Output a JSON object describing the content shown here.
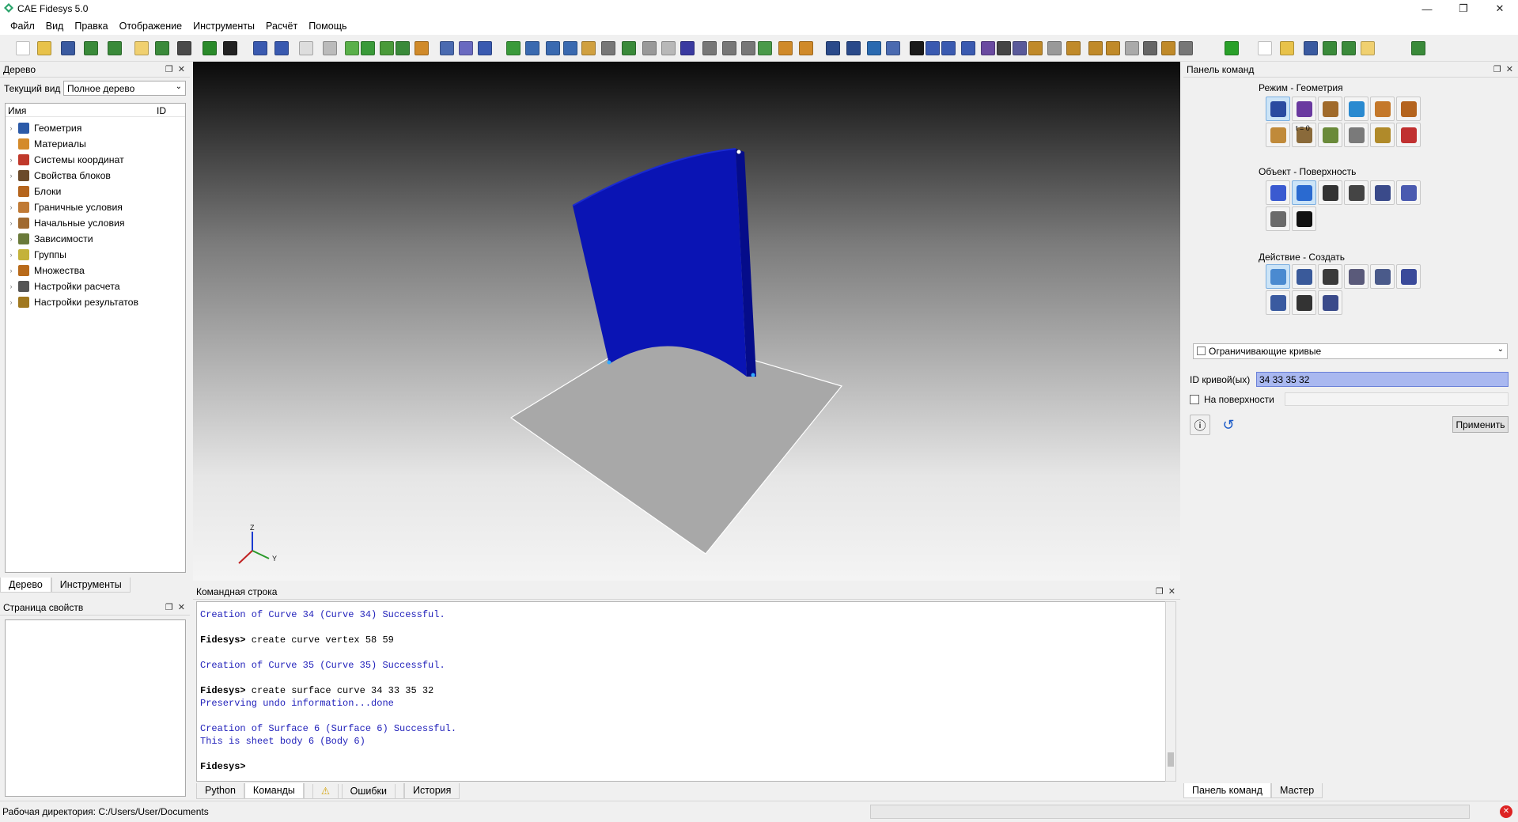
{
  "window": {
    "title": "CAE Fidesys 5.0",
    "min": "—",
    "max": "❐",
    "close": "✕"
  },
  "menu": [
    "Файл",
    "Вид",
    "Правка",
    "Отображение",
    "Инструменты",
    "Расчёт",
    "Помощь"
  ],
  "tree_panel": {
    "title": "Дерево",
    "current_view_label": "Текущий вид",
    "current_view_value": "Полное дерево",
    "col_name": "Имя",
    "col_id": "ID",
    "items": [
      {
        "label": "Геометрия",
        "icon": "geometry-icon",
        "color": "#2b5aa8",
        "expand": true
      },
      {
        "label": "Материалы",
        "icon": "materials-icon",
        "color": "#d48a2a",
        "expand": false
      },
      {
        "label": "Системы координат",
        "icon": "axes-icon",
        "color": "#c0392b",
        "expand": true
      },
      {
        "label": "Свойства блоков",
        "icon": "beam-icon",
        "color": "#6b4a2a",
        "expand": true
      },
      {
        "label": "Блоки",
        "icon": "blocks-icon",
        "color": "#b5651d",
        "expand": false
      },
      {
        "label": "Граничные условия",
        "icon": "boundary-icon",
        "color": "#c07a35",
        "expand": true
      },
      {
        "label": "Начальные условия",
        "icon": "initial-icon",
        "color": "#a06a30",
        "expand": true
      },
      {
        "label": "Зависимости",
        "icon": "chart-icon",
        "color": "#6a7a3a",
        "expand": true
      },
      {
        "label": "Группы",
        "icon": "groups-icon",
        "color": "#c4b23a",
        "expand": true
      },
      {
        "label": "Множества",
        "icon": "sets-icon",
        "color": "#b86a1a",
        "expand": true
      },
      {
        "label": "Настройки расчета",
        "icon": "calc-settings-icon",
        "color": "#555",
        "expand": true
      },
      {
        "label": "Настройки результатов",
        "icon": "results-icon",
        "color": "#a0781f",
        "expand": true
      }
    ],
    "tabs": [
      "Дерево",
      "Инструменты"
    ]
  },
  "props_panel": {
    "title": "Страница свойств"
  },
  "command_line": {
    "title": "Командная строка",
    "lines": [
      {
        "text": "Creation of Curve 34 (Curve 34) Successful.",
        "kind": "blue"
      },
      {
        "text": "",
        "kind": "blank"
      },
      {
        "text": "Fidesys> create curve vertex 58 59",
        "kind": "cmd"
      },
      {
        "text": "",
        "kind": "blank"
      },
      {
        "text": "Creation of Curve 35 (Curve 35) Successful.",
        "kind": "blue"
      },
      {
        "text": "",
        "kind": "blank"
      },
      {
        "text": "Fidesys> create surface curve 34 33 35 32",
        "kind": "cmd"
      },
      {
        "text": "Preserving undo information...done",
        "kind": "blue"
      },
      {
        "text": "",
        "kind": "blank"
      },
      {
        "text": "Creation of Surface 6 (Surface 6) Successful.",
        "kind": "blue"
      },
      {
        "text": "This is sheet body 6 (Body 6)",
        "kind": "blue"
      },
      {
        "text": "",
        "kind": "blank"
      },
      {
        "text": "Fidesys> ",
        "kind": "cmd"
      }
    ],
    "tabs": [
      "Python",
      "Команды",
      "Ошибки",
      "История"
    ]
  },
  "command_panel": {
    "title": "Панель команд",
    "mode_label": "Режим - Геометрия",
    "object_label": "Объект - Поверхность",
    "action_label": "Действие - Создать",
    "dropdown_value": "Ограничивающие кривые",
    "curve_id_label": "ID кривой(ых)",
    "curve_id_value": "34 33 35 32",
    "on_surface_label": "На поверхности",
    "apply_label": "Применить",
    "t0_label": "t = 0",
    "tabs": [
      "Панель команд",
      "Мастер"
    ]
  },
  "axes": {
    "z": "Z",
    "y": "Y"
  },
  "status": {
    "workdir": "Рабочая директория: C:/Users/User/Documents"
  },
  "colors": {
    "surface_blue": "#0a14b4",
    "plane_gray": "#a8a8a8",
    "accent": "#0078d7"
  }
}
